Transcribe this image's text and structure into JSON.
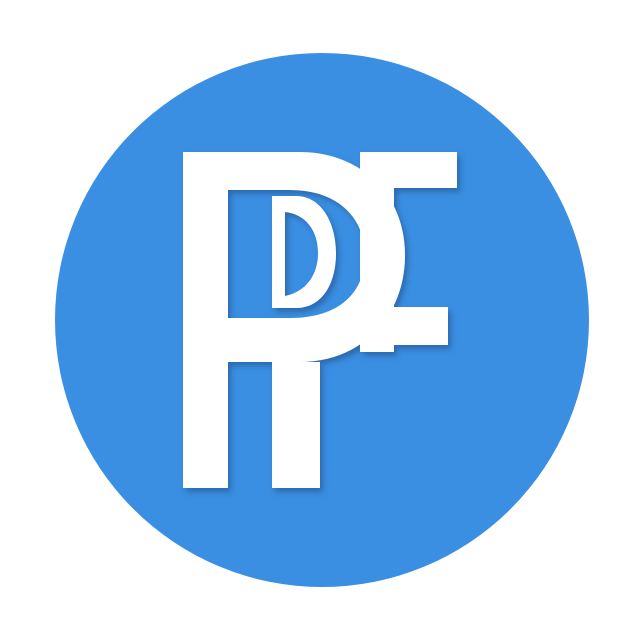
{
  "logo": {
    "monogram": "PF",
    "background_color": "#ffffff",
    "circle_color": "#3a8fe2",
    "letter_color": "#ffffff",
    "shadow_color": "#1f4e86"
  }
}
